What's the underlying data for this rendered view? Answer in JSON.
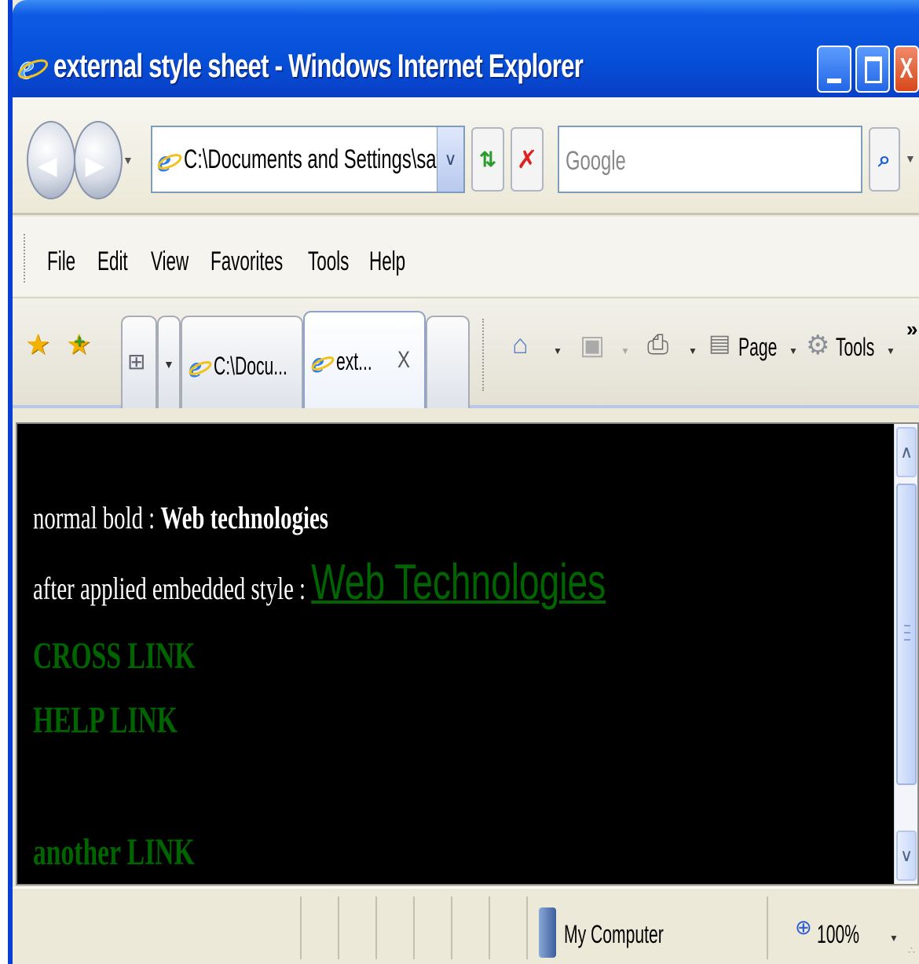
{
  "window": {
    "title": "external style sheet - Windows Internet Explorer",
    "close_glyph": "X"
  },
  "navbar": {
    "address": "C:\\Documents and Settings\\sati",
    "search_placeholder": "Google"
  },
  "menu": {
    "items": [
      "File",
      "Edit",
      "View",
      "Favorites",
      "Tools",
      "Help"
    ]
  },
  "tabs": {
    "items": [
      {
        "label": "C:\\Docu..."
      },
      {
        "label": "ext...",
        "close": "X"
      }
    ]
  },
  "commands": {
    "page_label": "Page",
    "tools_label": "Tools"
  },
  "content": {
    "line1_prefix": "normal bold : ",
    "line1_bold": "Web technologies",
    "line2_prefix": "after applied embedded style : ",
    "line2_styled": "Web Technologies",
    "links": [
      "CROSS LINK",
      "HELP LINK",
      "another LINK"
    ]
  },
  "statusbar": {
    "zone": "My Computer",
    "zoom": "100%"
  },
  "colors": {
    "content_bg": "#000000",
    "link_green": "#006400",
    "title_blue": "#0650d8"
  },
  "icons": {
    "ie": "ie-logo-icon",
    "back": "back-arrow-icon",
    "forward": "forward-arrow-icon",
    "refresh": "refresh-icon",
    "stop": "stop-icon",
    "search": "search-icon",
    "home": "home-icon",
    "feeds": "feeds-icon",
    "print": "print-icon",
    "page": "page-icon",
    "tools": "gear-icon",
    "computer": "computer-icon",
    "zoom": "zoom-icon"
  }
}
